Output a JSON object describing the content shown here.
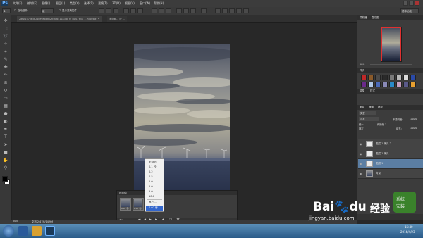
{
  "app": {
    "logo": "Ps"
  },
  "menu": [
    "文件(F)",
    "编辑(E)",
    "图像(I)",
    "图层(L)",
    "类型(Y)",
    "选择(S)",
    "滤镜(T)",
    "3D(D)",
    "视图(V)",
    "窗口(W)",
    "帮助(H)"
  ],
  "options": {
    "auto_select": "自动选择:",
    "group": "组",
    "show_transform": "显示变换控件"
  },
  "workspace": "基本功能",
  "doc_tabs": [
    "2af1f1675e5e24de9a6bd62fc3a6512a.jpg @ 50% (图层 1, RGB/8#) *",
    "未标题-1 @ ..."
  ],
  "tools": [
    "move",
    "marquee",
    "lasso",
    "wand",
    "crop",
    "eyedropper",
    "heal",
    "brush",
    "stamp",
    "history",
    "eraser",
    "gradient",
    "blur",
    "dodge",
    "pen",
    "type",
    "path-select",
    "shape",
    "hand",
    "zoom"
  ],
  "timeline": {
    "title": "时间轴",
    "frames": [
      {
        "index": "1",
        "delay": "0.07 秒"
      },
      {
        "index": "2",
        "delay": "0.07 秒"
      },
      {
        "index": "3",
        "delay": "0.07 秒"
      }
    ],
    "loop": "永远"
  },
  "frame_delay_menu": [
    "无延迟",
    "0.1 秒",
    "0.2",
    "0.5",
    "1.0",
    "2.0",
    "5.0",
    "10.0",
    "其它...",
    "0.07 秒"
  ],
  "frame_delay_selected": "0.07 秒",
  "navigator": {
    "tabs": [
      "导航器",
      "直方图"
    ],
    "zoom": "50%"
  },
  "swatches": {
    "tabs": [
      "样式"
    ],
    "colors": [
      "#c02828",
      "#8a5a2a",
      "#4a4a4a",
      "#2a2a2a",
      "#7a7a7a",
      "#b8b8b8",
      "#dcdcdc",
      "#2a4aa8",
      "#6a2a8a",
      "#b0c8e8",
      "#4a6ab8",
      "#8a8ab8",
      "#2a8ac8",
      "#c8a0c0",
      "#5a5a8a",
      "#e8a030"
    ]
  },
  "adjust_tabs": [
    "调整",
    "样式"
  ],
  "layers": {
    "tabs": [
      "图层",
      "通道",
      "路径"
    ],
    "kind": "类型",
    "blend_mode": "正常",
    "opacity_label": "不透明度:",
    "opacity": "100%",
    "lock_label": "锁定:",
    "fill_label": "填充:",
    "fill": "100%",
    "unify_label": "统一:",
    "propagate": "传播帧 1",
    "items": [
      {
        "name": "图层 1 拷贝 2",
        "selected": false
      },
      {
        "name": "图层 1 拷贝",
        "selected": false
      },
      {
        "name": "图层 1",
        "selected": true
      },
      {
        "name": "背景",
        "selected": false
      }
    ]
  },
  "status": {
    "zoom": "50%",
    "doc": "文档:2.47M/14.9M"
  },
  "taskbar": {
    "time": "15:40",
    "date": "2016/4/23"
  },
  "watermark": {
    "brand": "Bai",
    "brand2": "du",
    "jingyan": "经验",
    "url": "jingyan.baidu.com",
    "badge_line1": "系统",
    "badge_line2": "安装"
  },
  "colors": {
    "selected_layer": "#5b7ea3",
    "menu_highlight": "#3366cc"
  }
}
